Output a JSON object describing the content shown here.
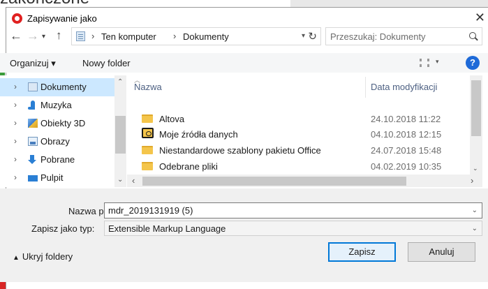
{
  "background": {
    "heading_fragment": "zakończone"
  },
  "dialog": {
    "title": "Zapisywanie jako",
    "close_glyph": "✕"
  },
  "address": {
    "crumbs": [
      "Ten komputer",
      "Dokumenty"
    ],
    "separator": "›"
  },
  "search": {
    "placeholder": "Przeszukaj: Dokumenty"
  },
  "toolbar": {
    "organize_label": "Organizuj ▾",
    "new_folder_label": "Nowy folder",
    "help_glyph": "?"
  },
  "nav_tree": {
    "items": [
      {
        "label": "Dokumenty",
        "icon": "documents-icon",
        "selected": true
      },
      {
        "label": "Muzyka",
        "icon": "music-icon",
        "selected": false
      },
      {
        "label": "Obiekty 3D",
        "icon": "objects-3d-icon",
        "selected": false
      },
      {
        "label": "Obrazy",
        "icon": "pictures-icon",
        "selected": false
      },
      {
        "label": "Pobrane",
        "icon": "downloads-icon",
        "selected": false
      },
      {
        "label": "Pulpit",
        "icon": "desktop-icon",
        "selected": false
      }
    ]
  },
  "file_list": {
    "columns": {
      "name": "Nazwa",
      "date": "Data modyfikacji"
    },
    "rows": [
      {
        "name": "Altova",
        "date": "24.10.2018 11:22",
        "icon": "folder-icon"
      },
      {
        "name": "Moje źródła danych",
        "date": "04.10.2018 12:15",
        "icon": "data-sources-folder-icon"
      },
      {
        "name": "Niestandardowe szablony pakietu Office",
        "date": "24.07.2018 15:48",
        "icon": "folder-icon"
      },
      {
        "name": "Odebrane pliki",
        "date": "04.02.2019 10:35",
        "icon": "folder-icon"
      }
    ]
  },
  "form": {
    "filename_label": "Nazwa pliku:",
    "filename_value": "mdr_2019131919 (5)",
    "type_label": "Zapisz jako typ:",
    "type_value": "Extensible Markup Language"
  },
  "footer": {
    "hide_folders_label": "Ukryj foldery",
    "save_label": "Zapisz",
    "cancel_label": "Anuluj"
  },
  "colors": {
    "accent": "#0078d7",
    "selection": "#cce8ff",
    "help": "#1e6ad8",
    "brand": "#e02020"
  }
}
